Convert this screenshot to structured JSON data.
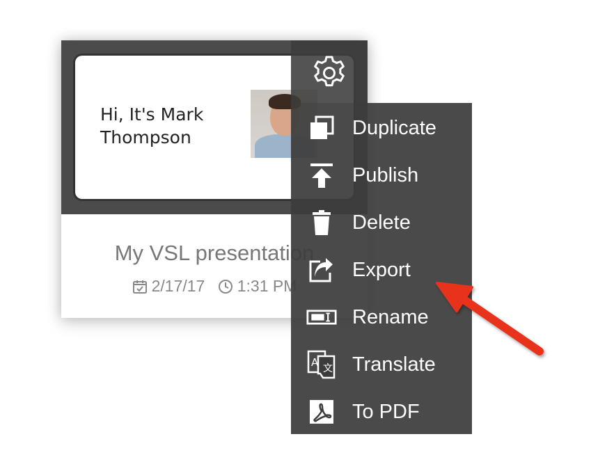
{
  "card": {
    "slide_line1": "Hi, It's Mark",
    "slide_line2": "Thompson",
    "title": "My VSL presentation",
    "date": "2/17/17",
    "time": "1:31 PM"
  },
  "menu": {
    "items": [
      {
        "label": "Duplicate",
        "icon": "duplicate-icon"
      },
      {
        "label": "Publish",
        "icon": "publish-icon"
      },
      {
        "label": "Delete",
        "icon": "trash-icon"
      },
      {
        "label": "Export",
        "icon": "export-icon"
      },
      {
        "label": "Rename",
        "icon": "rename-icon"
      },
      {
        "label": "Translate",
        "icon": "translate-icon"
      },
      {
        "label": "To PDF",
        "icon": "pdf-icon"
      }
    ]
  },
  "colors": {
    "menu_bg": "#3c3c3c",
    "arrow": "#e8321e",
    "title_text": "#777777"
  }
}
